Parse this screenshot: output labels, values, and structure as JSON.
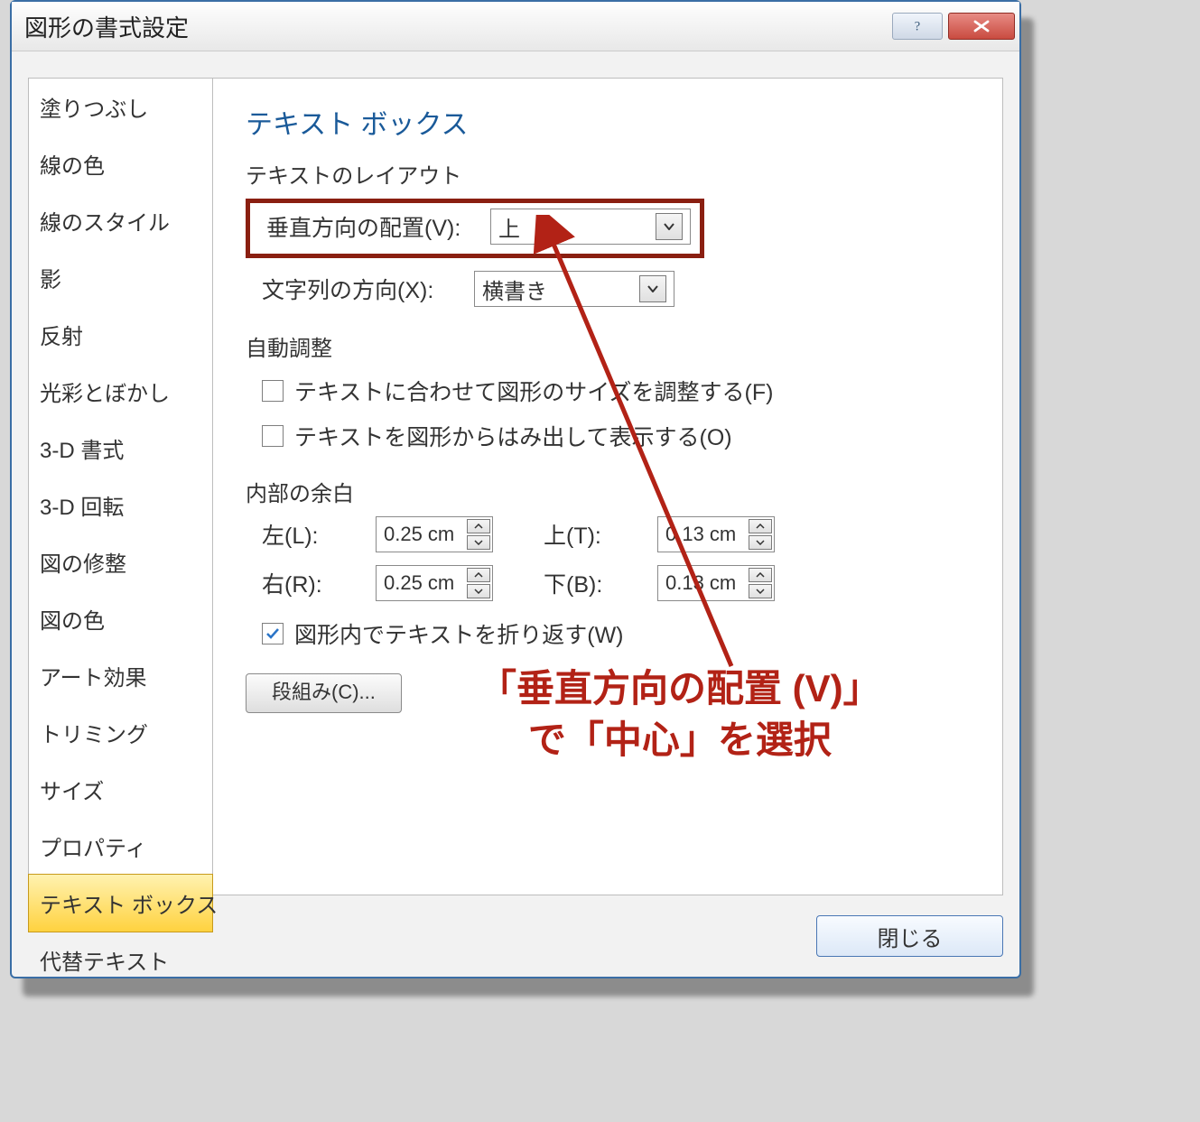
{
  "dialog": {
    "title": "図形の書式設定",
    "close_label": "閉じる"
  },
  "sidebar": {
    "items": [
      "塗りつぶし",
      "線の色",
      "線のスタイル",
      "影",
      "反射",
      "光彩とぼかし",
      "3-D 書式",
      "3-D 回転",
      "図の修整",
      "図の色",
      "アート効果",
      "トリミング",
      "サイズ",
      "プロパティ",
      "テキスト ボックス",
      "代替テキスト"
    ],
    "selected_index": 14
  },
  "panel": {
    "heading": "テキスト ボックス",
    "layout_section": "テキストのレイアウト",
    "valign_label": "垂直方向の配置(V):",
    "valign_value": "上",
    "textdir_label": "文字列の方向(X):",
    "textdir_value": "横書き",
    "autofit_section": "自動調整",
    "autofit_shape": "テキストに合わせて図形のサイズを調整する(F)",
    "autofit_overflow": "テキストを図形からはみ出して表示する(O)",
    "margin_section": "内部の余白",
    "margin_left_label": "左(L):",
    "margin_left_value": "0.25 cm",
    "margin_right_label": "右(R):",
    "margin_right_value": "0.25 cm",
    "margin_top_label": "上(T):",
    "margin_top_value": "0.13 cm",
    "margin_bottom_label": "下(B):",
    "margin_bottom_value": "0.13 cm",
    "wrap_label": "図形内でテキストを折り返す(W)",
    "columns_button": "段組み(C)..."
  },
  "annotation": {
    "line1": "「垂直方向の配置 (V)」",
    "line2": "で「中心」を選択"
  }
}
